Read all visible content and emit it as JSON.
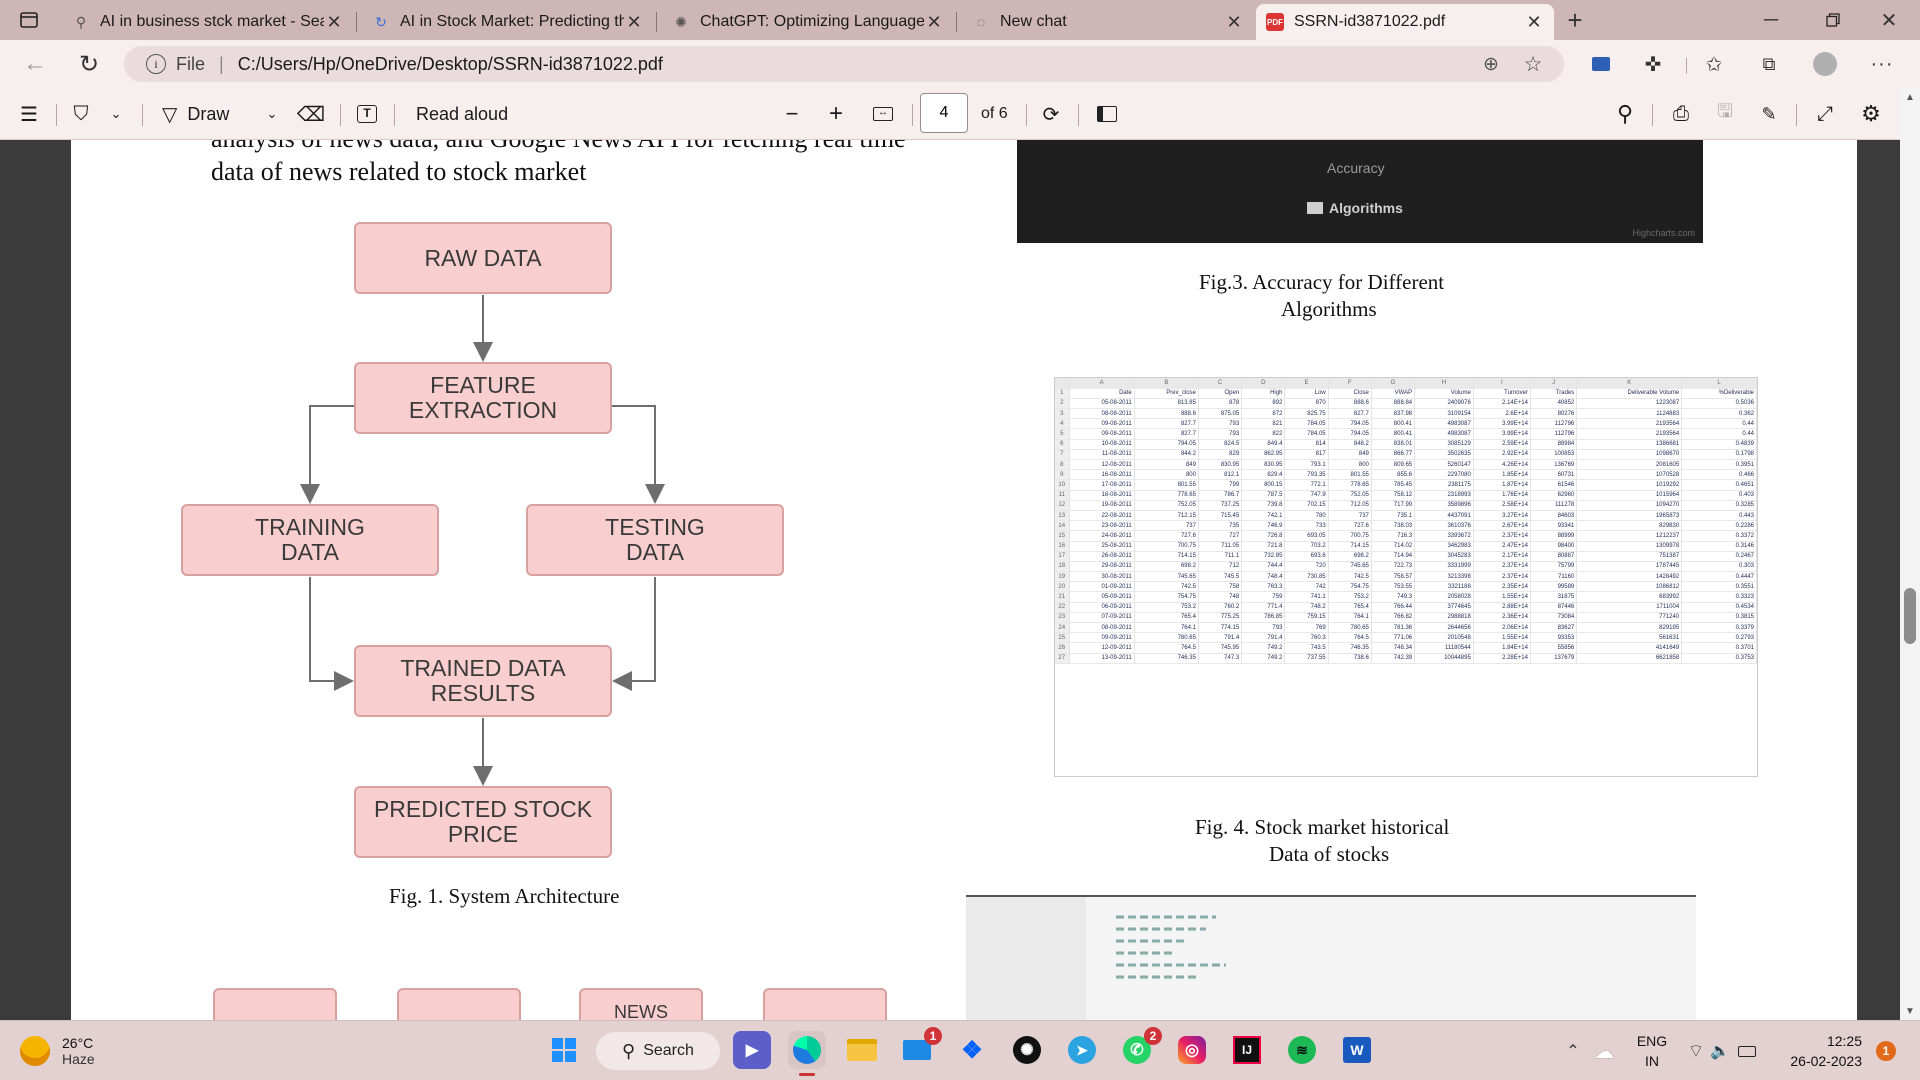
{
  "tabs": [
    {
      "title": "AI in business stck market - Sear",
      "icon": "search-icon",
      "active": false
    },
    {
      "title": "AI in Stock Market: Predicting the",
      "icon": "site-icon",
      "active": false
    },
    {
      "title": "ChatGPT: Optimizing Language M",
      "icon": "openai-icon",
      "active": false
    },
    {
      "title": "New chat",
      "icon": "chat-icon",
      "active": false
    },
    {
      "title": "SSRN-id3871022.pdf",
      "icon": "pdf-icon",
      "active": true
    }
  ],
  "address": {
    "scheme_label": "File",
    "url": "C:/Users/Hp/OneDrive/Desktop/SSRN-id3871022.pdf"
  },
  "pdf_toolbar": {
    "draw_label": "Draw",
    "read_aloud_label": "Read aloud",
    "page_current": "4",
    "page_total": "of 6"
  },
  "document": {
    "intro_line1": "analysis of news data, and Google News API for fetching real time",
    "intro_line2": "data of news related to stock market",
    "flow": {
      "raw": "RAW DATA",
      "feature": "FEATURE\nEXTRACTION",
      "training": "TRAINING\nDATA",
      "testing": "TESTING\nDATA",
      "trained": "TRAINED DATA\nRESULTS",
      "predicted": "PREDICTED STOCK\nPRICE"
    },
    "fig1_caption": "Fig. 1. System Architecture",
    "next_flow_partial": "NEWS",
    "chart_axis_label": "Accuracy",
    "chart_legend": "Algorithms",
    "chart_credit": "Highcharts.com",
    "fig3_caption_line1": "Fig.3. Accuracy for Different",
    "fig3_caption_line2": "Algorithms",
    "fig4_caption_line1": "Fig. 4. Stock market historical",
    "fig4_caption_line2": "Data of stocks"
  },
  "stock_table": {
    "col_letters": [
      "A",
      "B",
      "C",
      "D",
      "E",
      "F",
      "G",
      "H",
      "I",
      "J",
      "K",
      "L"
    ],
    "headers": [
      "Date",
      "Prev_close",
      "Open",
      "High",
      "Low",
      "Close",
      "VWAP",
      "Volume",
      "Turnover",
      "Trades",
      "Deliverable Volume",
      "%Deliverable"
    ],
    "rows": [
      [
        "05-08-2011",
        "813.85",
        "878",
        "892",
        "870",
        "888.6",
        "888.84",
        "2409076",
        "2.14E+14",
        "40852",
        "1223087",
        "0.5036"
      ],
      [
        "08-08-2011",
        "888.6",
        "875.05",
        "872",
        "825.75",
        "827.7",
        "837.98",
        "3109154",
        "2.6E+14",
        "80276",
        "1124883",
        "0.362"
      ],
      [
        "09-08-2011",
        "827.7",
        "793",
        "821",
        "784.05",
        "794.05",
        "800.41",
        "4983087",
        "3.99E+14",
        "112796",
        "2193564",
        "0.44"
      ],
      [
        "09-08-2011",
        "827.7",
        "793",
        "822",
        "784.05",
        "794.05",
        "800.41",
        "4983087",
        "3.99E+14",
        "112796",
        "2193564",
        "0.44"
      ],
      [
        "10-08-2011",
        "794.05",
        "824.5",
        "849.4",
        "814",
        "848.2",
        "838.01",
        "3085129",
        "2.59E+14",
        "88984",
        "1386681",
        "0.4839"
      ],
      [
        "11-08-2011",
        "844.2",
        "829",
        "862.95",
        "817",
        "849",
        "866.77",
        "3502635",
        "2.92E+14",
        "100853",
        "1098670",
        "0.1798"
      ],
      [
        "12-08-2011",
        "849",
        "830.95",
        "830.95",
        "793.1",
        "800",
        "809.65",
        "5260147",
        "4.26E+14",
        "136769",
        "2081605",
        "0.3951"
      ],
      [
        "16-08-2011",
        "800",
        "812.1",
        "829.4",
        "793.35",
        "801.55",
        "855.6",
        "2297080",
        "1.85E+14",
        "60731",
        "1070528",
        "0.466"
      ],
      [
        "17-08-2011",
        "801.55",
        "799",
        "800.15",
        "772.1",
        "778.65",
        "785.45",
        "2381175",
        "1.87E+14",
        "61546",
        "1019292",
        "0.4651"
      ],
      [
        "18-08-2011",
        "778.65",
        "786.7",
        "787.5",
        "747.9",
        "752.05",
        "758.12",
        "2318993",
        "1.76E+14",
        "62960",
        "1015964",
        "0.403"
      ],
      [
        "19-08-2011",
        "752.05",
        "737.25",
        "739.8",
        "702.15",
        "712.05",
        "717.99",
        "3589896",
        "2.58E+14",
        "111278",
        "1094270",
        "0.3285"
      ],
      [
        "22-08-2011",
        "712.15",
        "715.45",
        "742.1",
        "780",
        "737",
        "735.1",
        "4437091",
        "3.27E+14",
        "84603",
        "1965873",
        "0.443"
      ],
      [
        "23-08-2011",
        "737",
        "735",
        "746.9",
        "733",
        "727.6",
        "738.03",
        "3610376",
        "2.67E+14",
        "93341",
        "829830",
        "0.2286"
      ],
      [
        "24-08-2011",
        "727.6",
        "727",
        "726.8",
        "693.05",
        "700.75",
        "716.3",
        "3393672",
        "2.37E+14",
        "88999",
        "1212237",
        "0.3372"
      ],
      [
        "25-08-2011",
        "700.75",
        "711.05",
        "721.8",
        "703.2",
        "714.15",
        "714.02",
        "3462983",
        "2.47E+14",
        "98400",
        "1309978",
        "0.3146"
      ],
      [
        "26-08-2011",
        "714.15",
        "711.1",
        "732.85",
        "693.6",
        "698.2",
        "714.94",
        "3045283",
        "2.17E+14",
        "80887",
        "751387",
        "0.2467"
      ],
      [
        "29-08-2011",
        "698.2",
        "712",
        "744.4",
        "720",
        "745.65",
        "722.73",
        "3331999",
        "2.37E+14",
        "75799",
        "1787445",
        "0.303"
      ],
      [
        "30-08-2011",
        "745.65",
        "745.5",
        "748.4",
        "730.85",
        "742.5",
        "758.57",
        "3213398",
        "2.37E+14",
        "71160",
        "1428492",
        "0.4447"
      ],
      [
        "01-09-2011",
        "742.5",
        "758",
        "763.3",
        "742",
        "754.75",
        "753.55",
        "3321188",
        "2.35E+14",
        "99589",
        "1086812",
        "0.3551"
      ],
      [
        "05-09-2011",
        "754.75",
        "748",
        "759",
        "741.1",
        "753.2",
        "749.3",
        "2058028",
        "1.55E+14",
        "31875",
        "683992",
        "0.3323"
      ],
      [
        "06-09-2011",
        "753.2",
        "760.2",
        "771.4",
        "748.2",
        "765.4",
        "766.44",
        "3774645",
        "2.88E+14",
        "87446",
        "1711004",
        "0.4534"
      ],
      [
        "07-09-2011",
        "765.4",
        "775.25",
        "786.85",
        "759.15",
        "764.1",
        "766.82",
        "2988818",
        "2.36E+14",
        "73084",
        "771240",
        "0.3815"
      ],
      [
        "08-09-2011",
        "764.1",
        "774.15",
        "793",
        "769",
        "780.65",
        "781.36",
        "2644656",
        "2.06E+14",
        "83627",
        "829195",
        "0.3379"
      ],
      [
        "09-09-2011",
        "780.65",
        "791.4",
        "791.4",
        "760.3",
        "764.5",
        "771.06",
        "2010548",
        "1.55E+14",
        "93353",
        "561631",
        "0.2793"
      ],
      [
        "12-09-2011",
        "764.5",
        "745.95",
        "749.2",
        "743.5",
        "746.35",
        "748.34",
        "11180544",
        "1.84E+14",
        "55856",
        "4141649",
        "0.3701"
      ],
      [
        "13-09-2011",
        "746.35",
        "747.3",
        "749.2",
        "737.55",
        "738.6",
        "742.39",
        "10044895",
        "2.28E+14",
        "137679",
        "6621858",
        "0.3753"
      ]
    ]
  },
  "taskbar": {
    "weather_temp": "26°C",
    "weather_desc": "Haze",
    "search_label": "Search",
    "mail_badge": "1",
    "whatsapp_badge": "2",
    "lang_line1": "ENG",
    "lang_line2": "IN",
    "time": "12:25",
    "date": "26-02-2023",
    "notif_count": "1"
  },
  "colors": {
    "tabstrip": "#cfb6b6",
    "toolbar": "#f7eeee",
    "flow_box": "#f8cece",
    "flow_border": "#d9a0a0",
    "taskbar": "#e3d1d1"
  }
}
